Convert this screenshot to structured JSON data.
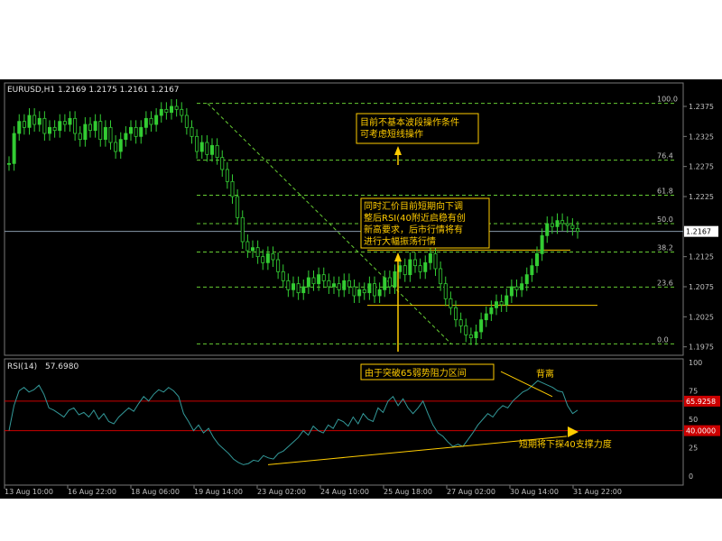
{
  "header": {
    "symbol_line": "EURUSD,H1  1.2169  1.2175  1.2161  1.2167"
  },
  "colors": {
    "background": "#000000",
    "grid": "#555555",
    "axis_text": "#c0c0c0",
    "candles": "#33cc33",
    "fib": "#66cc33",
    "fib_label": "#c0c0c0",
    "annotation": "#ffcc00",
    "rsi": "#339999",
    "rsi_level": "#cc0000",
    "current_price_line": "#8899aa"
  },
  "chart_data": [
    {
      "type": "candlestick",
      "title": "EURUSD,H1",
      "ohlc_header": {
        "open": 1.2169,
        "high": 1.2175,
        "low": 1.2161,
        "close": 1.2167
      },
      "current_price": {
        "value": 1.2167,
        "label": "1.2167"
      },
      "ylim": [
        1.197,
        1.239
      ],
      "y_ticks": [
        {
          "value": 1.2375,
          "label": "1.2375"
        },
        {
          "value": 1.2325,
          "label": "1.2325"
        },
        {
          "value": 1.2275,
          "label": "1.2275"
        },
        {
          "value": 1.2225,
          "label": "1.2225"
        },
        {
          "value": 1.2125,
          "label": "1.2125"
        },
        {
          "value": 1.2075,
          "label": "1.2075"
        },
        {
          "value": 1.2025,
          "label": "1.2025"
        },
        {
          "value": 1.1975,
          "label": "1.1975"
        }
      ],
      "x_ticks": [
        "13 Aug 10:00",
        "16 Aug 22:00",
        "18 Aug 06:00",
        "19 Aug 14:00",
        "23 Aug 02:00",
        "24 Aug 10:00",
        "25 Aug 18:00",
        "27 Aug 02:00",
        "30 Aug 14:00",
        "31 Aug 22:00"
      ],
      "closes": [
        1.228,
        1.233,
        1.235,
        1.234,
        1.236,
        1.2345,
        1.2355,
        1.233,
        1.234,
        1.2335,
        1.235,
        1.2345,
        1.2355,
        1.233,
        1.232,
        1.2345,
        1.2335,
        1.235,
        1.232,
        1.234,
        1.2315,
        1.23,
        1.232,
        1.233,
        1.234,
        1.2325,
        1.234,
        1.2355,
        1.2345,
        1.236,
        1.237,
        1.2365,
        1.2375,
        1.237,
        1.236,
        1.234,
        1.2325,
        1.23,
        1.2315,
        1.2295,
        1.231,
        1.229,
        1.227,
        1.225,
        1.2225,
        1.219,
        1.215,
        1.2135,
        1.214,
        1.2125,
        1.2115,
        1.213,
        1.212,
        1.21,
        1.2085,
        1.207,
        1.208,
        1.2065,
        1.2075,
        1.209,
        1.208,
        1.2095,
        1.2085,
        1.2075,
        1.208,
        1.207,
        1.2085,
        1.2075,
        1.206,
        1.207,
        1.2065,
        1.208,
        1.206,
        1.207,
        1.209,
        1.2075,
        1.21,
        1.211,
        1.2095,
        1.212,
        1.211,
        1.21,
        1.2115,
        1.213,
        1.2105,
        1.208,
        1.2055,
        1.204,
        1.202,
        1.201,
        1.1995,
        1.199,
        1.2,
        1.202,
        1.203,
        1.204,
        1.205,
        1.2045,
        1.206,
        1.2075,
        1.207,
        1.208,
        1.2095,
        1.211,
        1.213,
        1.216,
        1.218,
        1.2175,
        1.2185,
        1.218,
        1.2177,
        1.2172,
        1.2167
      ],
      "fibonacci": {
        "high": 1.238,
        "low": 1.198,
        "levels": [
          {
            "ratio": 1.0,
            "label": "100.0"
          },
          {
            "ratio": 0.764,
            "label": "76.4"
          },
          {
            "ratio": 0.618,
            "label": "61.8"
          },
          {
            "ratio": 0.5,
            "label": "50.0"
          },
          {
            "ratio": 0.382,
            "label": "38.2"
          },
          {
            "ratio": 0.236,
            "label": "23.6"
          },
          {
            "ratio": 0.0,
            "label": "0.0"
          }
        ]
      },
      "annotations": [
        {
          "lines": [
            "目前不基本波段操作条件",
            "可考虑短线操作"
          ]
        },
        {
          "lines": [
            "同时汇价目前短期向下调",
            "整后RSI(40附近启稳有创",
            "新高要求，后市行情将有",
            "进行大幅振荡行情"
          ]
        }
      ]
    },
    {
      "type": "line",
      "title": "RSI(14)",
      "title_value": "57.6980",
      "ylim": [
        0,
        100
      ],
      "y_ticks": [
        "100",
        "75",
        "50",
        "25",
        "0"
      ],
      "levels": [
        {
          "value": 65.9258,
          "label": "65.9258"
        },
        {
          "value": 40.0,
          "label": "40.0000"
        }
      ],
      "values": [
        40,
        62,
        75,
        78,
        74,
        76,
        80,
        72,
        60,
        58,
        55,
        52,
        58,
        60,
        54,
        56,
        52,
        58,
        50,
        55,
        48,
        46,
        52,
        56,
        60,
        57,
        64,
        70,
        66,
        72,
        76,
        74,
        78,
        75,
        70,
        55,
        48,
        40,
        45,
        38,
        42,
        34,
        28,
        24,
        20,
        15,
        12,
        10,
        11,
        14,
        13,
        18,
        16,
        15,
        20,
        22,
        26,
        30,
        34,
        40,
        36,
        44,
        40,
        38,
        45,
        42,
        50,
        48,
        44,
        52,
        46,
        55,
        50,
        48,
        60,
        56,
        66,
        70,
        62,
        68,
        60,
        55,
        60,
        66,
        55,
        45,
        38,
        35,
        30,
        26,
        28,
        26,
        32,
        38,
        45,
        50,
        55,
        52,
        58,
        62,
        60,
        66,
        70,
        74,
        76,
        80,
        84,
        82,
        80,
        78,
        75,
        74,
        62,
        55,
        58
      ],
      "annotations": [
        {
          "text": "由于突破65弱势阻力区间"
        },
        {
          "text": "背离"
        },
        {
          "text": "短期将下探40支撑力度"
        }
      ]
    }
  ]
}
